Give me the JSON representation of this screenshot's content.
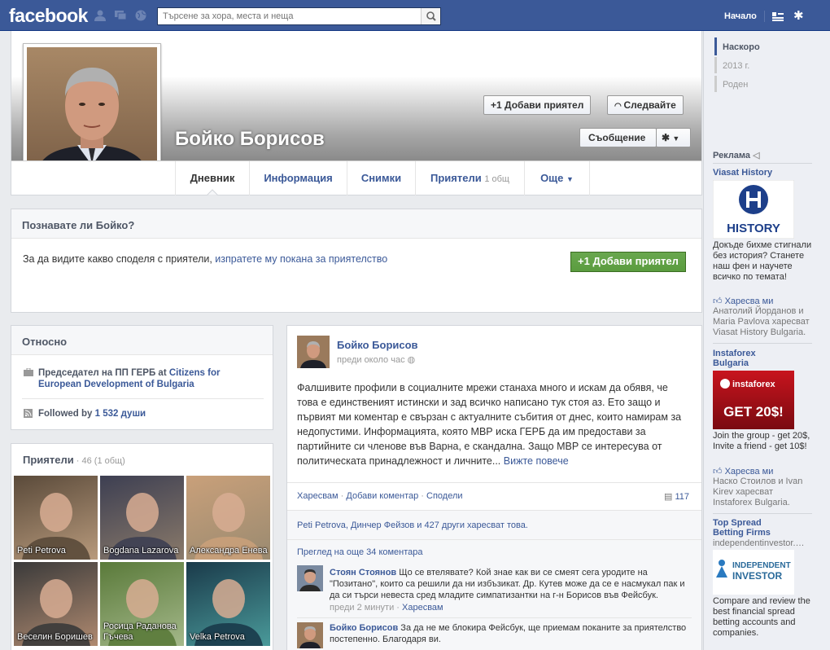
{
  "topbar": {
    "logo": "facebook",
    "search_placeholder": "Търсене за хора, места и неща",
    "home": "Начало"
  },
  "profile": {
    "name": "Бойко Борисов",
    "add_friend": "Добави приятел",
    "follow": "Следвайте",
    "message": "Съобщение"
  },
  "tabs": [
    {
      "label": "Дневник",
      "sub": ""
    },
    {
      "label": "Информация",
      "sub": ""
    },
    {
      "label": "Снимки",
      "sub": ""
    },
    {
      "label": "Приятели",
      "sub": "1 общ"
    },
    {
      "label": "Още",
      "sub": ""
    }
  ],
  "know": {
    "title": "Познавате ли Бойко?",
    "text": "За да видите какво споделя с приятели, ",
    "link": "изпратете му покана за приятелство",
    "button": "Добави приятел"
  },
  "about": {
    "title": "Относно",
    "work_prefix": "Председател на ПП ГЕРБ at ",
    "work_org": "Citizens for European Development of Bulgaria",
    "followed_prefix": "Followed by ",
    "followed_count": "1 532 души"
  },
  "friends": {
    "title": "Приятели",
    "count": " · 46 (1 общ)",
    "items": [
      {
        "name": "Peti Petrova",
        "color1": "#5a4a3a",
        "color2": "#b89a7c"
      },
      {
        "name": "Bogdana Lazarova",
        "color1": "#3d3f52",
        "color2": "#8a7a6a"
      },
      {
        "name": "Александра Енева",
        "color1": "#c9a07a",
        "color2": "#9a8a70"
      },
      {
        "name": "Веселин Боришев",
        "color1": "#3a3a3a",
        "color2": "#b08a70"
      },
      {
        "name": "Росица Раданова Гъчева",
        "color1": "#5a7a3a",
        "color2": "#a4b88a"
      },
      {
        "name": "Velka Petrova",
        "color1": "#1a3a4a",
        "color2": "#4a9a9a"
      }
    ]
  },
  "post": {
    "author": "Бойко Борисов",
    "time": "преди около час",
    "text": "Фалшивите профили в социалните мрежи станаха много и искам да обявя, че това е единственият истински и зад всичко написано тук стоя аз. Ето защо и първият ми коментар е свързан с актуалните събития от днес, които намирам за недопустими. Информацията, която МВР иска ГЕРБ да им предостави за партийните си членове във Варна, е скандална. Защо МВР се интересува от политическата принадлежност и личните...",
    "see_more": "Вижте повече",
    "like": "Харесвам",
    "comment": "Добави коментар",
    "share": "Сподели",
    "comment_count": "117",
    "likes_text": "Peti Petrova, Динчер Фейзов и 427 други харесват това.",
    "more_comments": "Преглед на още 34 коментара",
    "comments": [
      {
        "author": "Стоян Стоянов",
        "text": "Що се втелявате? Кой знае как ви се смеят сега уродите на \"Позитано\", които са решили да ни избъзикат. Др. Кутев може да се е насмукал пак и да си търси невеста сред младите симпатизантки на г-н Борисов във Фейсбук.",
        "time": "преди 2 минути",
        "like": "Харесвам"
      },
      {
        "author": "Бойко Борисов",
        "text": "За да не ме блокира Фейсбук, ще приемам поканите за приятелство постепенно. Благодаря ви.",
        "time": "",
        "like": ""
      }
    ]
  },
  "timeline": [
    "Наскоро",
    "2013 г.",
    "Роден"
  ],
  "ads": {
    "header": "Реклама",
    "items": [
      {
        "title": "Viasat History",
        "text": "Докъде бихме стигнали без история? Станете наш фен и научете всичко по темата!",
        "like": "Харесва ми",
        "social": "Анатолий Йорданов и Maria Pavlova харесват Viasat History Bulgaria.",
        "img_label": "HISTORY"
      },
      {
        "title": "Instaforex Bulgaria",
        "text": "Join the group - get 20$, Invite a friend - get 10$!",
        "like": "Харесва ми",
        "social": "Наско Стоилов и Ivan Kirev харесват Instaforex Bulgaria.",
        "img_label": "GET 20$!",
        "img_brand": "instaforex"
      },
      {
        "title": "Top Spread Betting Firms",
        "domain": "independentinvestor.…",
        "text": "Compare and review the best financial spread betting accounts and companies.",
        "img_label1": "INDEPENDENT",
        "img_label2": "INVESTOR"
      }
    ]
  }
}
